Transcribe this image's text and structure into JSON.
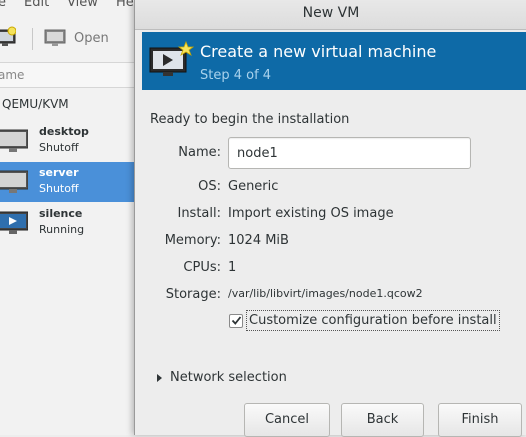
{
  "background_window": {
    "menu": [
      "e",
      "Edit",
      "View",
      "He"
    ],
    "toolbar": {
      "open_label": "Open"
    },
    "column_header": "ame",
    "connection": "QEMU/KVM",
    "vms": [
      {
        "name": "desktop",
        "state": "Shutoff",
        "selected": false,
        "icon": "monitor-off-icon"
      },
      {
        "name": "server",
        "state": "Shutoff",
        "selected": true,
        "icon": "monitor-off-icon"
      },
      {
        "name": "silence",
        "state": "Running",
        "selected": false,
        "icon": "monitor-running-icon"
      }
    ]
  },
  "dialog": {
    "title": "New VM",
    "banner": {
      "title": "Create a new virtual machine",
      "step": "Step 4 of 4"
    },
    "ready_text": "Ready to begin the installation",
    "fields": {
      "name_label": "Name:",
      "name_value": "node1",
      "os_label": "OS:",
      "os_value": "Generic",
      "install_label": "Install:",
      "install_value": "Import existing OS image",
      "memory_label": "Memory:",
      "memory_value": "1024 MiB",
      "cpus_label": "CPUs:",
      "cpus_value": "1",
      "storage_label": "Storage:",
      "storage_value": "/var/lib/libvirt/images/node1.qcow2"
    },
    "customize_label": "Customize configuration before install",
    "customize_checked": true,
    "network_label": "Network selection",
    "buttons": {
      "cancel": "Cancel",
      "back": "Back",
      "finish": "Finish"
    }
  },
  "colors": {
    "banner": "#0e6aa7",
    "selection": "#4a90d9"
  }
}
